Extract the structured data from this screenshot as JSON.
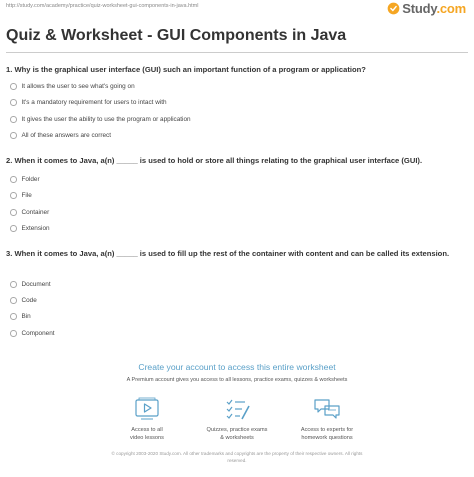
{
  "header": {
    "url": "http://study.com/academy/practice/quiz-worksheet-gui-components-in-java.html",
    "logo_text": "Study",
    "logo_suffix": ".com"
  },
  "title": "Quiz & Worksheet - GUI Components in Java",
  "questions": [
    {
      "text": "1. Why is the graphical user interface (GUI) such an important function of a program or application?",
      "options": [
        "It allows the user to see what's going on",
        "It's a mandatory requirement for users to intact with",
        "It gives the user the ability to use the program or application",
        "All of these answers are correct"
      ]
    },
    {
      "text": "2. When it comes to Java, a(n) _____ is used to hold or store all things relating to the graphical user interface (GUI).",
      "options": [
        "Folder",
        "File",
        "Container",
        "Extension"
      ]
    },
    {
      "text": "3. When it comes to Java, a(n) _____ is used to fill up the rest of the container with content and can be called its extension.",
      "options": [
        "Document",
        "Code",
        "Bin",
        "Component"
      ]
    }
  ],
  "promo": {
    "title": "Create your account to access this entire worksheet",
    "subtitle": "A Premium account gives you access to all lessons, practice exams, quizzes & worksheets"
  },
  "features": [
    {
      "icon": "video-lessons-icon",
      "line1": "Access to all",
      "line2": "video lessons"
    },
    {
      "icon": "quizzes-checklist-icon",
      "line1": "Quizzes, practice exams",
      "line2": "& worksheets"
    },
    {
      "icon": "experts-chat-icon",
      "line1": "Access to experts for",
      "line2": "homework questions"
    }
  ],
  "footer": {
    "line1": "© copyright 2003-2020 Study.com. All other trademarks and copyrights are the property of their respective owners. All rights",
    "line2": "reserved."
  },
  "colors": {
    "accent": "#5aa0c8",
    "logo_dot": "#f5a623"
  }
}
